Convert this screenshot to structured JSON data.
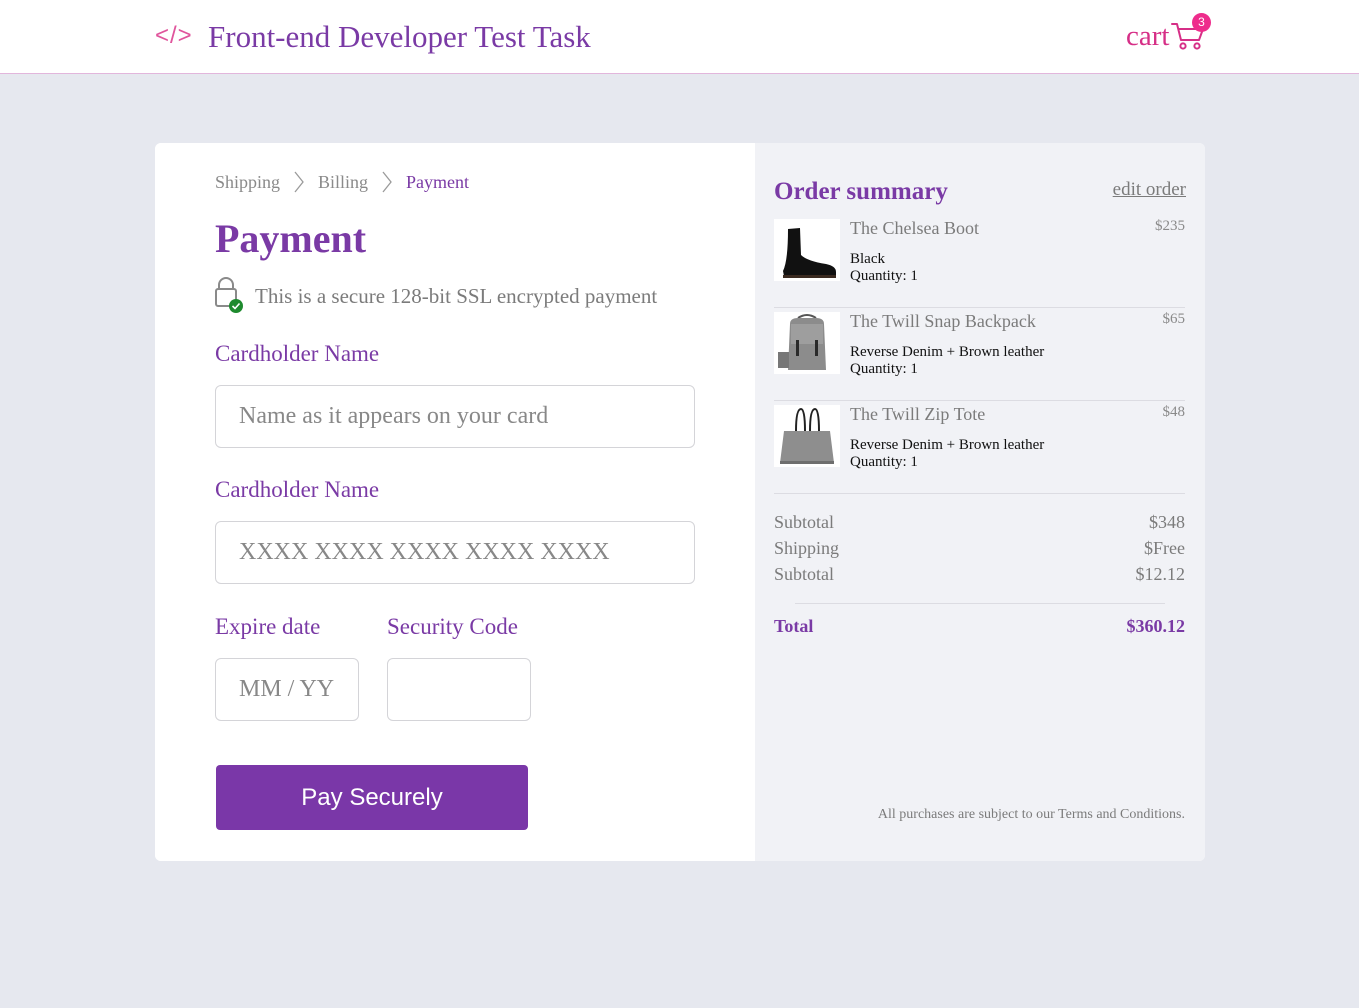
{
  "header": {
    "logo_symbol": "</>",
    "title": "Front-end Developer Test Task",
    "cart_label": "cart",
    "cart_count": "3"
  },
  "checkout": {
    "breadcrumb": [
      "Shipping",
      "Billing",
      "Payment"
    ],
    "title": "Payment",
    "secure_note": "This is a secure 128-bit SSL encrypted payment",
    "cardholder_label": "Cardholder Name",
    "cardholder_placeholder": "Name as it appears on your card",
    "card_number_label": "Cardholder Name",
    "card_number_placeholder": "XXXX XXXX XXXX XXXX XXXX",
    "expire_label": "Expire date",
    "expire_placeholder": "MM / YY",
    "security_label": "Security Code",
    "security_placeholder": "",
    "pay_button": "Pay Securely"
  },
  "summary": {
    "title": "Order summary",
    "edit_link": "edit order",
    "items": [
      {
        "name": "The Chelsea Boot",
        "price": "$235",
        "variant": "Black",
        "quantity": "Quantity: 1",
        "icon": "boot-icon"
      },
      {
        "name": "The Twill Snap Backpack",
        "price": "$65",
        "variant": "Reverse Denim + Brown leather",
        "quantity": "Quantity: 1",
        "icon": "backpack-icon"
      },
      {
        "name": "The Twill Zip Tote",
        "price": "$48",
        "variant": "Reverse Denim + Brown leather",
        "quantity": "Quantity: 1",
        "icon": "tote-icon"
      }
    ],
    "subtotal_label": "Subtotal",
    "subtotal_value": "$348",
    "shipping_label": "Shipping",
    "shipping_value": "$Free",
    "tax_label": "Subtotal",
    "tax_value": "$12.12",
    "total_label": "Total",
    "total_value": "$360.12",
    "terms": "All purchases are subject to our Terms and Conditions."
  },
  "colors": {
    "brand_purple": "#7a3aa5",
    "accent_pink": "#d62f87",
    "button_purple": "#7a37a8",
    "badge_pink": "#ee2c8c",
    "secure_check_green": "#1e8a2e",
    "page_background": "#e6e8ef"
  }
}
